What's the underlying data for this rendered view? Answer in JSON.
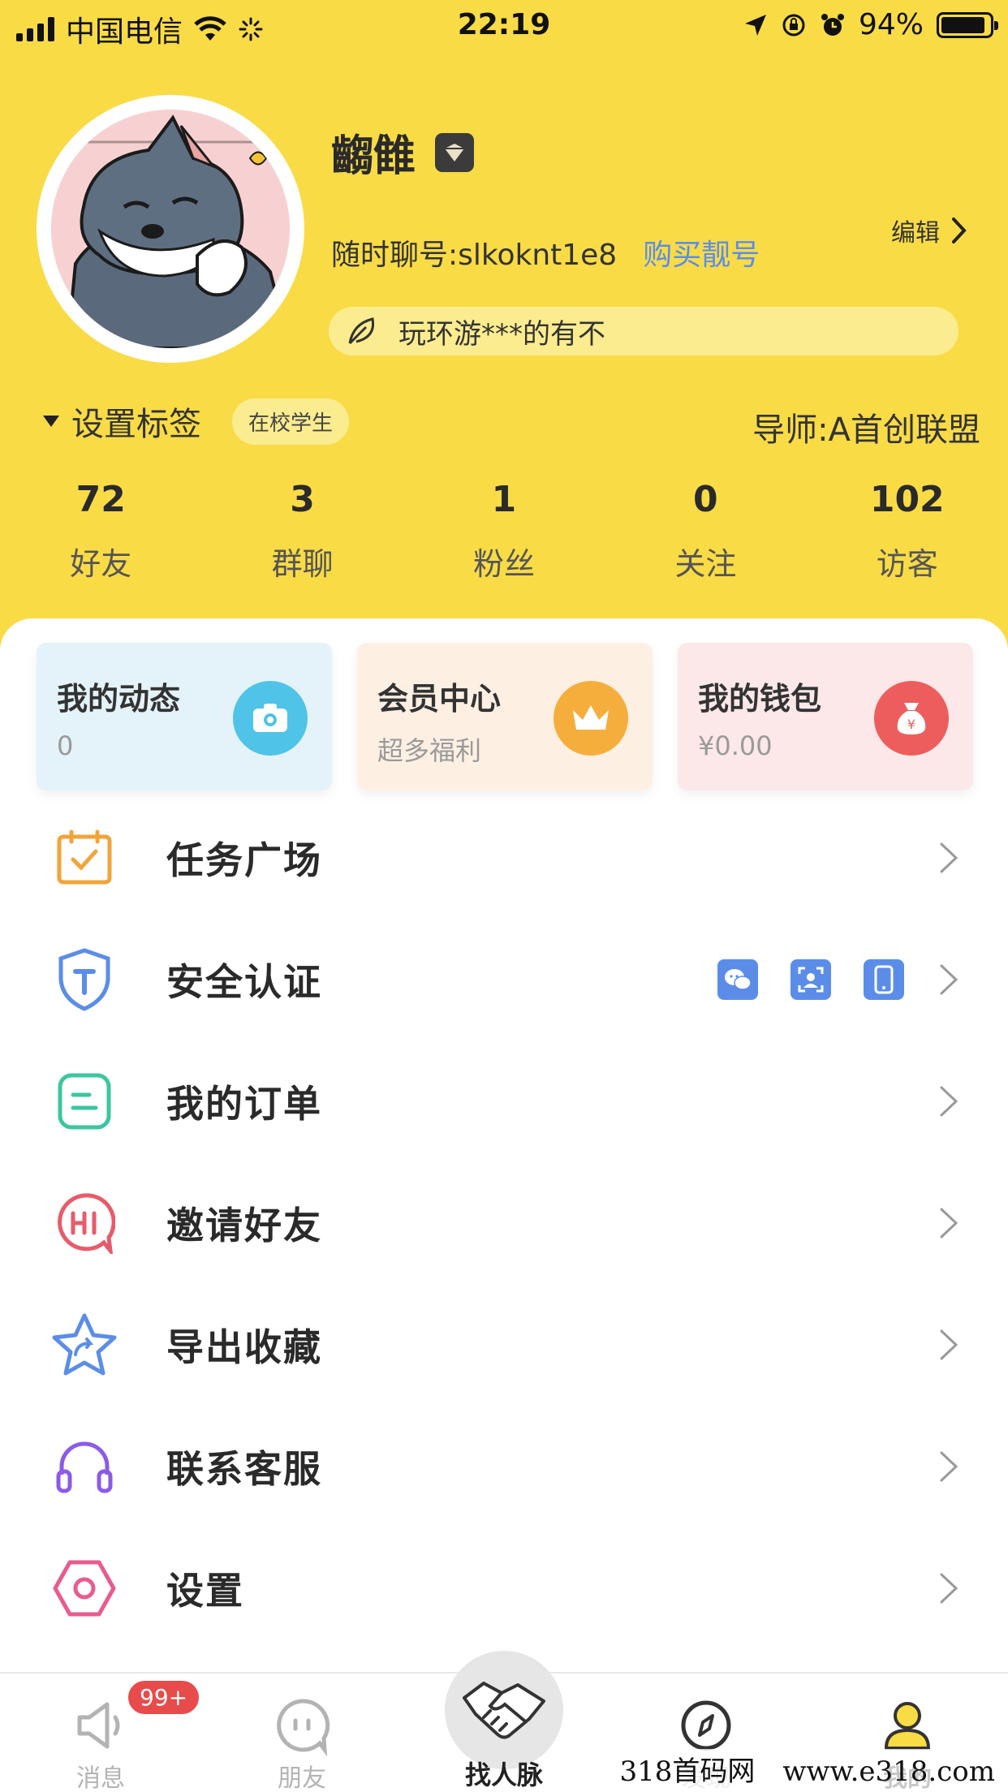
{
  "status_bar": {
    "carrier": "中国电信",
    "time": "22:19",
    "battery": "94%"
  },
  "profile": {
    "name": "齺雔",
    "account_label": "随时聊号:slkoknt1e8",
    "buy_number": "购买靓号",
    "edit": "编辑",
    "signature": "玩环游***的有不",
    "tag_toggle": "设置标签",
    "tag_chip": "在校学生",
    "mentor": "导师:A首创联盟"
  },
  "stats": [
    {
      "value": "72",
      "label": "好友"
    },
    {
      "value": "3",
      "label": "群聊"
    },
    {
      "value": "1",
      "label": "粉丝"
    },
    {
      "value": "0",
      "label": "关注"
    },
    {
      "value": "102",
      "label": "访客"
    }
  ],
  "cards": {
    "moments": {
      "title": "我的动态",
      "sub": "0",
      "icon": "camera-icon",
      "color": "#4FC3E8"
    },
    "vip": {
      "title": "会员中心",
      "sub": "超多福利",
      "icon": "crown-icon",
      "color": "#F5AE3C"
    },
    "wallet": {
      "title": "我的钱包",
      "sub": "¥0.00",
      "icon": "money-bag-icon",
      "color": "#EE5D5D"
    }
  },
  "menu": [
    {
      "label": "任务广场",
      "icon": "calendar-check-icon",
      "color": "#F0A53A"
    },
    {
      "label": "安全认证",
      "icon": "shield-icon",
      "color": "#5B8DE8"
    },
    {
      "label": "我的订单",
      "icon": "order-icon",
      "color": "#3CC6A0"
    },
    {
      "label": "邀请好友",
      "icon": "hi-bubble-icon",
      "color": "#E85B6A"
    },
    {
      "label": "导出收藏",
      "icon": "star-share-icon",
      "color": "#5B8DE8"
    },
    {
      "label": "联系客服",
      "icon": "headphones-icon",
      "color": "#8B5BE8"
    },
    {
      "label": "设置",
      "icon": "hexagon-settings-icon",
      "color": "#E85B8F"
    }
  ],
  "tabbar": {
    "messages": "消息",
    "badge": "99+",
    "friends": "朋友",
    "center": "找人脉",
    "discover": "发现",
    "mine": "我的"
  },
  "watermark": "318首码网　www.e318.com"
}
